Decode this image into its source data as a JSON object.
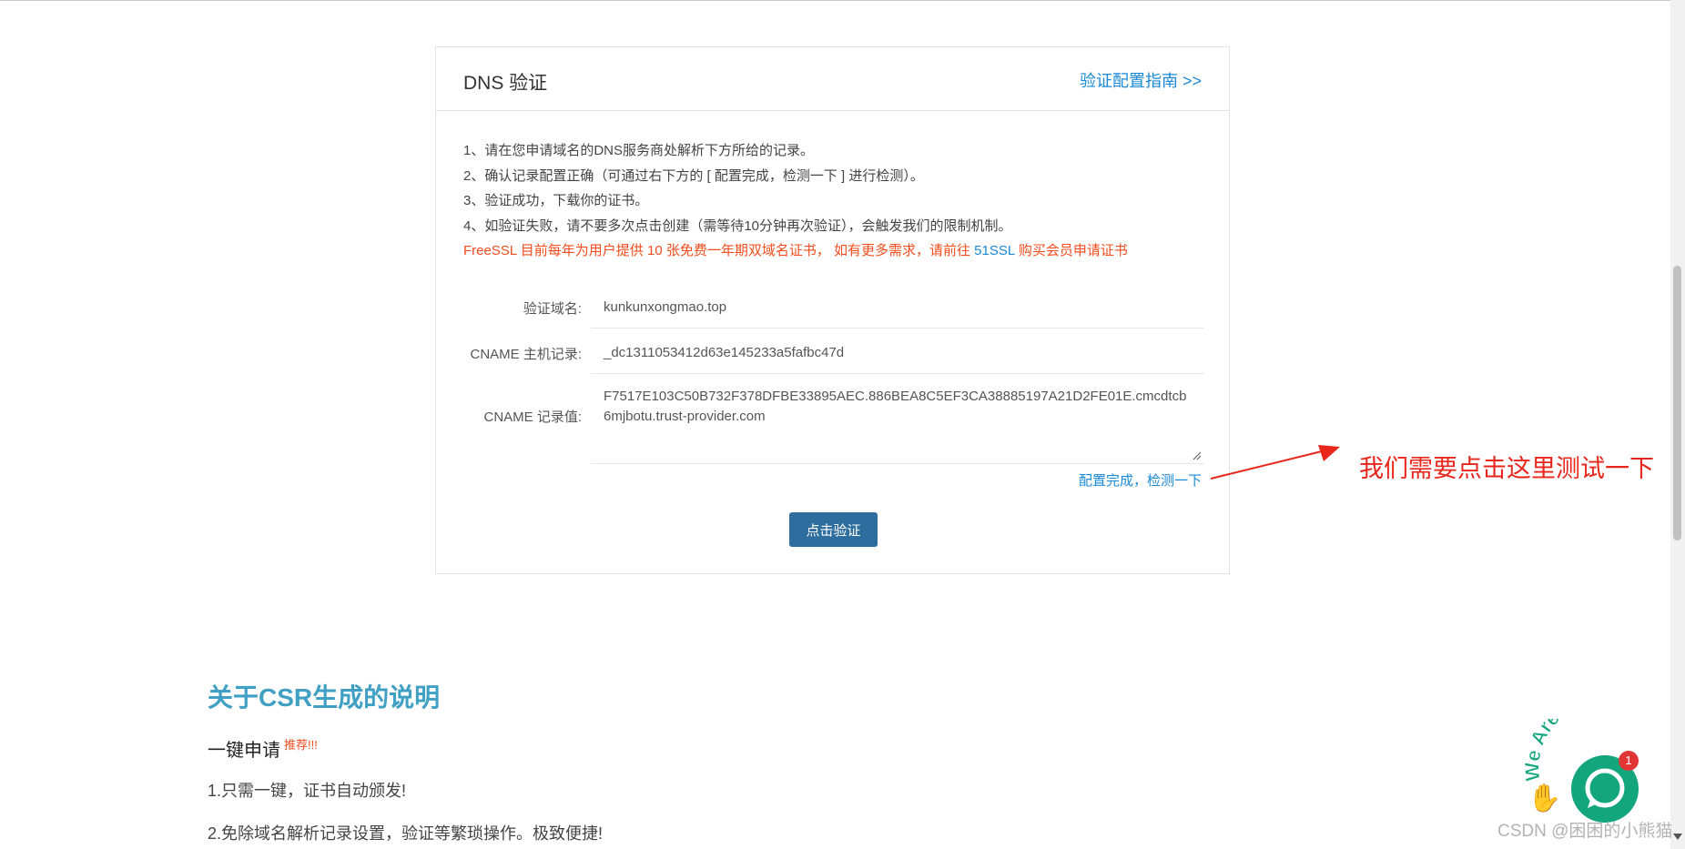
{
  "dns": {
    "title": "DNS 验证",
    "guide_link": "验证配置指南 >>",
    "steps": [
      "1、请在您申请域名的DNS服务商处解析下方所给的记录。",
      "2、确认记录配置正确（可通过右下方的 [ 配置完成，检测一下 ] 进行检测）。",
      "3、验证成功，下载你的证书。",
      "4、如验证失败，请不要多次点击创建（需等待10分钟再次验证），会触发我们的限制机制。"
    ],
    "notice_before": "FreeSSL 目前每年为用户提供 10 张免费一年期双域名证书， 如有更多需求，请前往 ",
    "notice_link": "51SSL",
    "notice_after": " 购买会员申请证书",
    "fields": [
      {
        "label": "验证域名:",
        "value": "kunkunxongmao.top"
      },
      {
        "label": "CNAME 主机记录:",
        "value": "_dc1311053412d63e145233a5fafbc47d"
      },
      {
        "label": "CNAME 记录值:",
        "value": "F7517E103C50B732F378DFBE33895AEC.886BEA8C5EF3CA38885197A21D2FE01E.cmcdtcb6mjbotu.trust-provider.com"
      }
    ],
    "check_link": "配置完成，检测一下",
    "verify_button": "点击验证"
  },
  "annotation": "我们需要点击这里测试一下",
  "csr": {
    "title": "关于CSR生成的说明",
    "onekey": "一键申请",
    "recommend": "推荐!!!",
    "p1": "1.只需一键，证书自动颁发!",
    "p2": "2.免除域名解析记录设置，验证等繁琐操作。极致便捷!"
  },
  "chat": {
    "badge_count": "1",
    "banner": "We Are Here!"
  },
  "watermark": "CSDN @困困的小熊猫",
  "colors": {
    "link": "#1a8ad6",
    "notice": "#f24d1e",
    "button": "#2e6e9e",
    "annotation": "#e8261c",
    "csr_title": "#3fa0c4",
    "chat": "#13a57c"
  }
}
